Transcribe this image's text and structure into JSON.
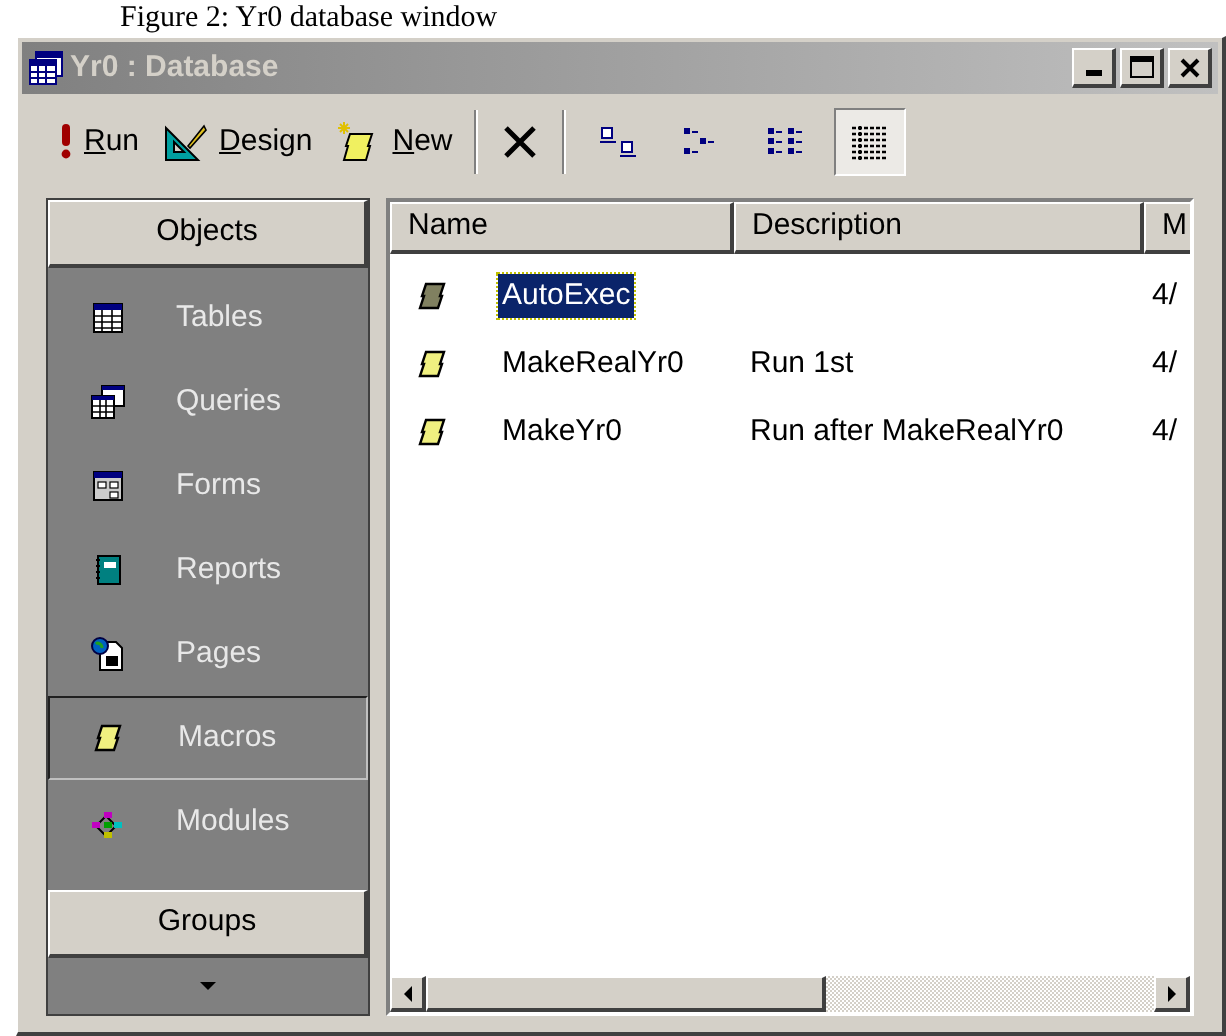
{
  "caption": "Figure 2: Yr0 database window",
  "window": {
    "title": "Yr0 : Database"
  },
  "toolbar": {
    "actions": [
      {
        "kind": "run",
        "label": "Run"
      },
      {
        "kind": "design",
        "label": "Design"
      },
      {
        "kind": "new",
        "label": "New"
      },
      {
        "kind": "delete"
      }
    ],
    "views": [
      {
        "kind": "large",
        "selected": false
      },
      {
        "kind": "small",
        "selected": false
      },
      {
        "kind": "list",
        "selected": false
      },
      {
        "kind": "details",
        "selected": true
      }
    ]
  },
  "sidebar": {
    "header": "Objects",
    "items": [
      {
        "kind": "tables",
        "label": "Tables",
        "selected": false
      },
      {
        "kind": "queries",
        "label": "Queries",
        "selected": false
      },
      {
        "kind": "forms",
        "label": "Forms",
        "selected": false
      },
      {
        "kind": "reports",
        "label": "Reports",
        "selected": false
      },
      {
        "kind": "pages",
        "label": "Pages",
        "selected": false
      },
      {
        "kind": "macros",
        "label": "Macros",
        "selected": true
      },
      {
        "kind": "modules",
        "label": "Modules",
        "selected": false
      }
    ],
    "groups": "Groups"
  },
  "table": {
    "columns": [
      "Name",
      "Description",
      "M"
    ],
    "rows": [
      {
        "name": "AutoExec",
        "description": "",
        "column_3": "4/",
        "selected": true
      },
      {
        "name": "MakeRealYr0",
        "description": "Run 1st",
        "column_3": "4/",
        "selected": false
      },
      {
        "name": "MakeYr0",
        "description": "Run after MakeRealYr0",
        "column_3": "4/",
        "selected": false
      }
    ]
  }
}
